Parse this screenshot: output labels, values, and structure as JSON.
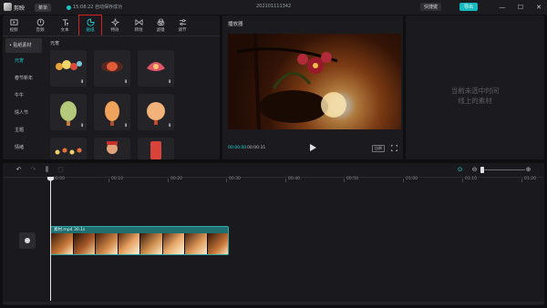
{
  "titlebar": {
    "app_name": "剪映",
    "menu_label": "菜单",
    "save_status": "15:08:22 自动保存成功",
    "project_name": "202101111342",
    "shortcut_label": "快捷键",
    "export_label": "导出",
    "minimize": "—",
    "maximize": "☐",
    "close": "✕"
  },
  "tabs": [
    {
      "label": "视频",
      "icon": "video-icon"
    },
    {
      "label": "音频",
      "icon": "audio-icon"
    },
    {
      "label": "文本",
      "icon": "text-icon"
    },
    {
      "label": "贴纸",
      "icon": "sticker-icon"
    },
    {
      "label": "特效",
      "icon": "effects-icon"
    },
    {
      "label": "转场",
      "icon": "transition-icon"
    },
    {
      "label": "滤镜",
      "icon": "filter-icon"
    },
    {
      "label": "调节",
      "icon": "adjust-icon"
    }
  ],
  "categories": [
    "• 贴纸素材",
    "元宵",
    "春节新年",
    "牛牛",
    "情人节",
    "主题",
    "情绪"
  ],
  "section_title": "元宵",
  "player": {
    "title": "播放器",
    "current_time": "00:00:00",
    "total_time": "00:00:31",
    "ratio_label": "比例"
  },
  "detail": {
    "empty_line1": "当前未选中时间",
    "empty_line2": "线上的素材"
  },
  "timeline": {
    "ticks": [
      "00:00",
      "00:10",
      "00:20",
      "00:30",
      "00:40",
      "00:50",
      "01:00",
      "01:10",
      "01:20"
    ],
    "clip_label": "素材.mp4   30.1s"
  },
  "colors": {
    "accent": "#1fd0d3",
    "highlight_border": "#d92020",
    "clip": "#1f6f70"
  }
}
